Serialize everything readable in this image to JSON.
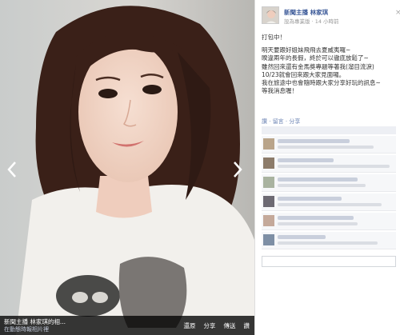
{
  "photo": {
    "alt": "",
    "caption_title": "新聞主播 林家琪的相...",
    "caption_subtitle": "在動態時報相片裡",
    "actions": [
      "還原",
      "分享",
      "傳送",
      "讚"
    ]
  },
  "author": {
    "name": "新聞主播 林家琪",
    "meta": "設為專業版 · 14 小時前",
    "close_label": "×"
  },
  "post": {
    "lines": [
      "打包中！",
      "",
      "明天要跟好姐妹飛飛去夏威夷囉~",
      "睽違兩年的長假，終於可以徹底放鬆了~",
      "雖然回來還有金馬獎專題等著我(溜目流淚)",
      "10/23就會回來跟大家見面囉。",
      "我在旅途中也會隨時跟大家分享好玩的訊息~",
      "等我消息喔！"
    ]
  },
  "actions_row": {
    "like": "讚",
    "comment": "留言",
    "share": "分享"
  },
  "colors": {
    "link": "#3b5998",
    "caption_bg": "#000000"
  }
}
